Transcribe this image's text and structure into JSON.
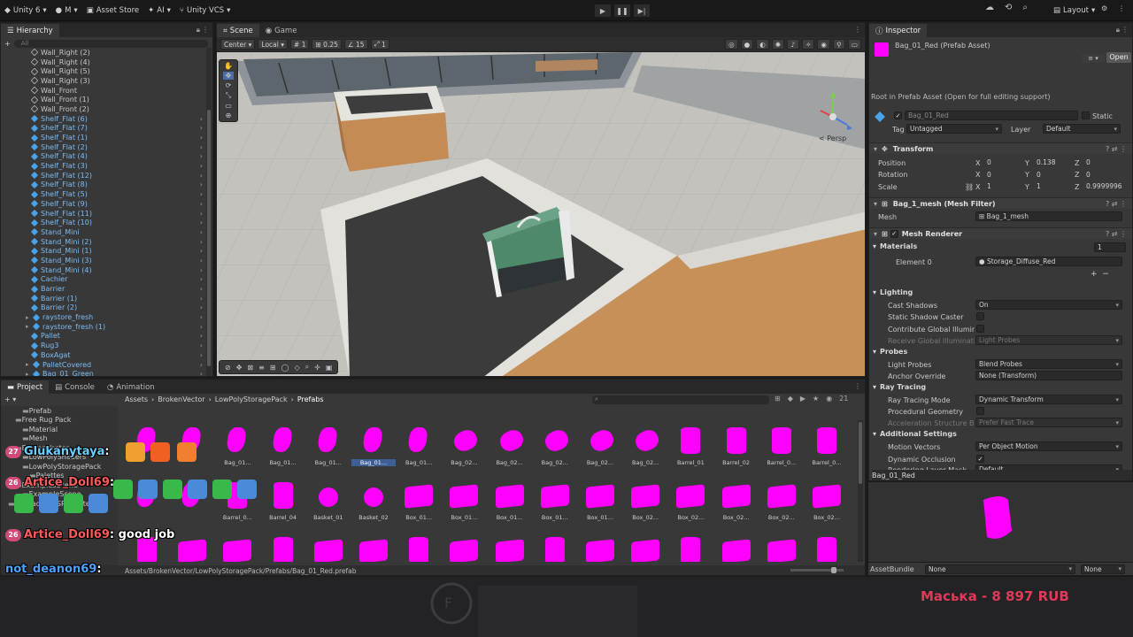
{
  "topbar": {
    "account": "Unity 6",
    "user": "M",
    "asset_store": "Asset Store",
    "ai": "AI",
    "vcs": "Unity VCS",
    "layout": "Layout"
  },
  "hierarchy": {
    "tab": "Hierarchy",
    "search_placeholder": "All",
    "items": [
      {
        "name": "Wall_Right (2)",
        "prefab": false,
        "arrow": false
      },
      {
        "name": "Wall_Right (4)",
        "prefab": false,
        "arrow": false
      },
      {
        "name": "Wall_Right (5)",
        "prefab": false,
        "arrow": false
      },
      {
        "name": "Wall_Right (3)",
        "prefab": false,
        "arrow": false
      },
      {
        "name": "Wall_Front",
        "prefab": false,
        "arrow": false
      },
      {
        "name": "Wall_Front (1)",
        "prefab": false,
        "arrow": false
      },
      {
        "name": "Wall_Front (2)",
        "prefab": false,
        "arrow": false
      },
      {
        "name": "Shelf_Flat (6)",
        "prefab": true,
        "arrow": true
      },
      {
        "name": "Shelf_Flat (7)",
        "prefab": true,
        "arrow": true
      },
      {
        "name": "Shelf_Flat (1)",
        "prefab": true,
        "arrow": true
      },
      {
        "name": "Shelf_Flat (2)",
        "prefab": true,
        "arrow": true
      },
      {
        "name": "Shelf_Flat (4)",
        "prefab": true,
        "arrow": true
      },
      {
        "name": "Shelf_Flat (3)",
        "prefab": true,
        "arrow": true
      },
      {
        "name": "Shelf_Flat (12)",
        "prefab": true,
        "arrow": true
      },
      {
        "name": "Shelf_Flat (8)",
        "prefab": true,
        "arrow": true
      },
      {
        "name": "Shelf_Flat (5)",
        "prefab": true,
        "arrow": true
      },
      {
        "name": "Shelf_Flat (9)",
        "prefab": true,
        "arrow": true
      },
      {
        "name": "Shelf_Flat (11)",
        "prefab": true,
        "arrow": true
      },
      {
        "name": "Shelf_Flat (10)",
        "prefab": true,
        "arrow": true
      },
      {
        "name": "Stand_Mini",
        "prefab": true,
        "arrow": true
      },
      {
        "name": "Stand_Mini (2)",
        "prefab": true,
        "arrow": true
      },
      {
        "name": "Stand_Mini (1)",
        "prefab": true,
        "arrow": true
      },
      {
        "name": "Stand_Mini (3)",
        "prefab": true,
        "arrow": true
      },
      {
        "name": "Stand_Mini (4)",
        "prefab": true,
        "arrow": true
      },
      {
        "name": "Cachier",
        "prefab": true,
        "arrow": true
      },
      {
        "name": "Barrier",
        "prefab": true,
        "arrow": true
      },
      {
        "name": "Barrier (1)",
        "prefab": true,
        "arrow": true
      },
      {
        "name": "Barrier (2)",
        "prefab": true,
        "arrow": true
      },
      {
        "name": "raystore_fresh",
        "prefab": true,
        "arrow": true,
        "fold": true
      },
      {
        "name": "raystore_fresh (1)",
        "prefab": true,
        "arrow": true,
        "fold": true
      },
      {
        "name": "Pallet",
        "prefab": true,
        "arrow": true
      },
      {
        "name": "Rug3",
        "prefab": true,
        "arrow": true
      },
      {
        "name": "BoxAgat",
        "prefab": true,
        "arrow": true
      },
      {
        "name": "PalletCovered",
        "prefab": true,
        "arrow": true,
        "fold": true
      },
      {
        "name": "Bag_01_Green",
        "prefab": true,
        "arrow": true,
        "fold": true
      }
    ]
  },
  "scene": {
    "tabs": [
      "Scene",
      "Game"
    ],
    "pivot": "Center",
    "space": "Local",
    "grid": "1",
    "snap": "0.25",
    "angle": "15",
    "scale_snap": "1",
    "persp": "< Persp"
  },
  "inspector": {
    "tab": "Inspector",
    "title": "Bag_01_Red (Prefab Asset)",
    "open": "Open",
    "root_note": "Root in Prefab Asset (Open for full editing support)",
    "object_name": "Bag_01_Red",
    "static": "Static",
    "tag_label": "Tag",
    "tag": "Untagged",
    "layer_label": "Layer",
    "layer": "Default",
    "transform": {
      "title": "Transform",
      "position_label": "Position",
      "rotation_label": "Rotation",
      "scale_label": "Scale",
      "position": [
        "0",
        "0.138",
        "0"
      ],
      "rotation": [
        "0",
        "0",
        "0"
      ],
      "scale": [
        "1",
        "1",
        "0.9999996"
      ]
    },
    "mesh_filter": {
      "title": "Bag_1_mesh (Mesh Filter)",
      "mesh_label": "Mesh",
      "mesh": "Bag_1_mesh"
    },
    "mesh_renderer": {
      "title": "Mesh Renderer",
      "materials_label": "Materials",
      "materials_count": "1",
      "element_label": "Element 0",
      "element": "Storage_Diffuse_Red",
      "lighting": "Lighting",
      "cast_shadows_label": "Cast Shadows",
      "cast_shadows": "On",
      "static_shadow_label": "Static Shadow Caster",
      "contribute_gi_label": "Contribute Global Illuminati",
      "receive_gi_label": "Receive Global Illuminati",
      "receive_gi": "Light Probes",
      "probes": "Probes",
      "light_probes_label": "Light Probes",
      "light_probes": "Blend Probes",
      "anchor_label": "Anchor Override",
      "anchor": "None (Transform)",
      "ray_tracing": "Ray Tracing",
      "rt_mode_label": "Ray Tracing Mode",
      "rt_mode": "Dynamic Transform",
      "procedural_label": "Procedural Geometry",
      "accel_label": "Acceleration Structure Bui",
      "accel": "Prefer Fast Trace",
      "additional": "Additional Settings",
      "motion_label": "Motion Vectors",
      "motion": "Per Object Motion",
      "occlusion_label": "Dynamic Occlusion",
      "rlm_label": "Rendering Layer Mask",
      "rlm": "Default"
    },
    "preview_title": "Bag_01_Red",
    "assetbundle_label": "AssetBundle",
    "assetbundle": "None",
    "assetbundle_variant": "None"
  },
  "project": {
    "tabs": [
      "Project",
      "Console",
      "Animation"
    ],
    "breadcrumb": [
      "Assets",
      "BrokenVector",
      "LowPolyStoragePack",
      "Prefabs"
    ],
    "count": "21",
    "tree": [
      {
        "name": "Prefab",
        "depth": 2
      },
      {
        "name": "Free Rug Pack",
        "depth": 1
      },
      {
        "name": "Material",
        "depth": 2
      },
      {
        "name": "Mesh",
        "depth": 2
      },
      {
        "name": "BrokenVector",
        "depth": 1
      },
      {
        "name": "LowPolyShaders",
        "depth": 2
      },
      {
        "name": "LowPolyStoragePack",
        "depth": 2
      },
      {
        "name": "Palettes",
        "depth": 3
      },
      {
        "name": "ExamplesScene",
        "depth": 1
      },
      {
        "name": "ExampleScene",
        "depth": 2
      },
      {
        "name": "Upgrade to SRP Material",
        "depth": 0
      }
    ],
    "row1_labels": [
      "",
      "",
      "Bag_01...",
      "Bag_01...",
      "Bag_01...",
      "Bag_01...",
      "Bag_01...",
      "Bag_02...",
      "Bag_02...",
      "Bag_02...",
      "Bag_02...",
      "Bag_02...",
      "Barrel_01",
      "Barrel_02",
      "Barrel_0...",
      "Barrel_0..."
    ],
    "row2_labels": [
      "",
      "",
      "Barrel_0...",
      "Barrel_04",
      "Basket_01",
      "Basket_02",
      "Box_01...",
      "Box_01...",
      "Box_01...",
      "Box_01...",
      "Box_01...",
      "Box_02...",
      "Box_02...",
      "Box_02...",
      "Box_02...",
      "Box_02..."
    ],
    "status_path": "Assets/BrokenVector/LowPolyStoragePack/Prefabs/Bag_01_Red.prefab"
  },
  "chat": [
    {
      "badge": "27",
      "user": "Glukanytaya",
      "color": "#6ad0ff",
      "text": ""
    },
    {
      "badge": "26",
      "user": "Artice_Doll69",
      "color": "#ff5a5a",
      "text": ""
    },
    {
      "badge": "26",
      "user": "Artice_Doll69",
      "color": "#ff5a5a",
      "text": "good job"
    },
    {
      "badge": "",
      "user": "not_deanon69",
      "color": "#4aa3ff",
      "text": ""
    },
    {
      "badge": "",
      "user": "not_deanon69",
      "color": "#4aa3ff",
      "text": ""
    }
  ],
  "donation": "Маська - 8 897 RUB",
  "colors": {
    "accent": "#3e5f96",
    "prefab": "#7cbcf5",
    "missing_material": "#ff00ff",
    "bag_green": "#4e8a6a"
  }
}
